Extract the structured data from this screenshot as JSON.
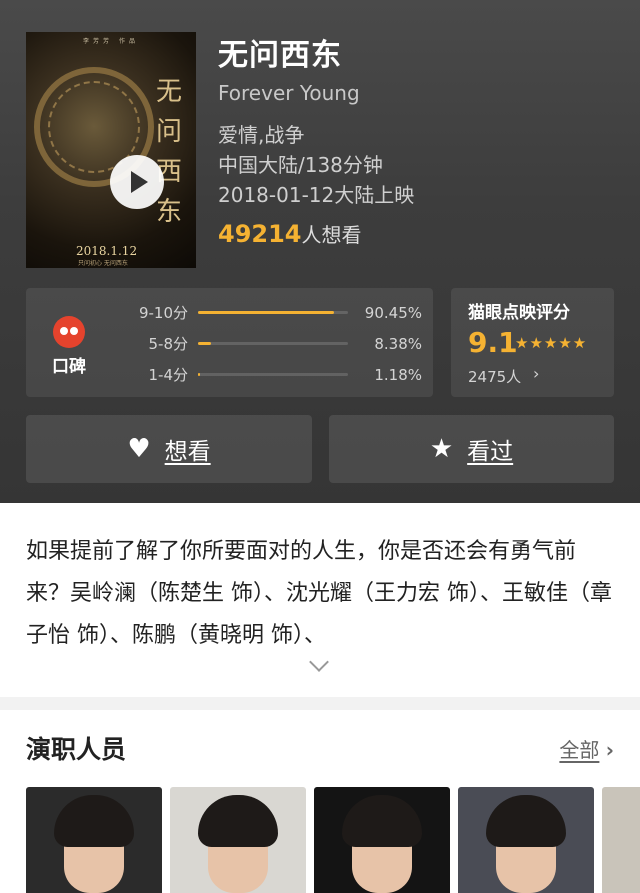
{
  "movie": {
    "title": "无问西东",
    "title_en": "Forever Young",
    "genres": "爱情,战争",
    "region_duration": "中国大陆/138分钟",
    "release": "2018-01-12大陆上映",
    "want_count": "49214",
    "want_suffix": "人想看",
    "poster": {
      "vertical_title": "无问西东",
      "top_text": "李芳芳 作品",
      "date": "2018.1.12",
      "date_sub": "只问初心 无问西东",
      "play_icon": "play-icon"
    }
  },
  "ratings": {
    "badge": "口碑",
    "rows": [
      {
        "label": "9-10分",
        "pct": "90.45%",
        "fraction": 0.9045
      },
      {
        "label": "5-8分",
        "pct": "8.38%",
        "fraction": 0.0838
      },
      {
        "label": "1-4分",
        "pct": "1.18%",
        "fraction": 0.0118
      }
    ]
  },
  "score": {
    "title": "猫眼点映评分",
    "value": "9.1",
    "stars": "★★★★★",
    "count": "2475人",
    "chevron": "›"
  },
  "actions": {
    "want_label": "想看",
    "want_icon": "heart-icon",
    "seen_label": "看过",
    "seen_icon": "star-icon"
  },
  "synopsis": {
    "text": "如果提前了解了你所要面对的人生，你是否还会有勇气前来？吴岭澜（陈楚生 饰）、沈光耀（王力宏 饰）、王敏佳（章子怡 饰）、陈鹏（黄晓明 饰）、"
  },
  "cast": {
    "title": "演职人员",
    "all_label": "全部",
    "chevron": "›"
  },
  "colors": {
    "accent": "#f5b232",
    "header_bg": "#3d3d3d",
    "brand_red": "#e5432d"
  }
}
